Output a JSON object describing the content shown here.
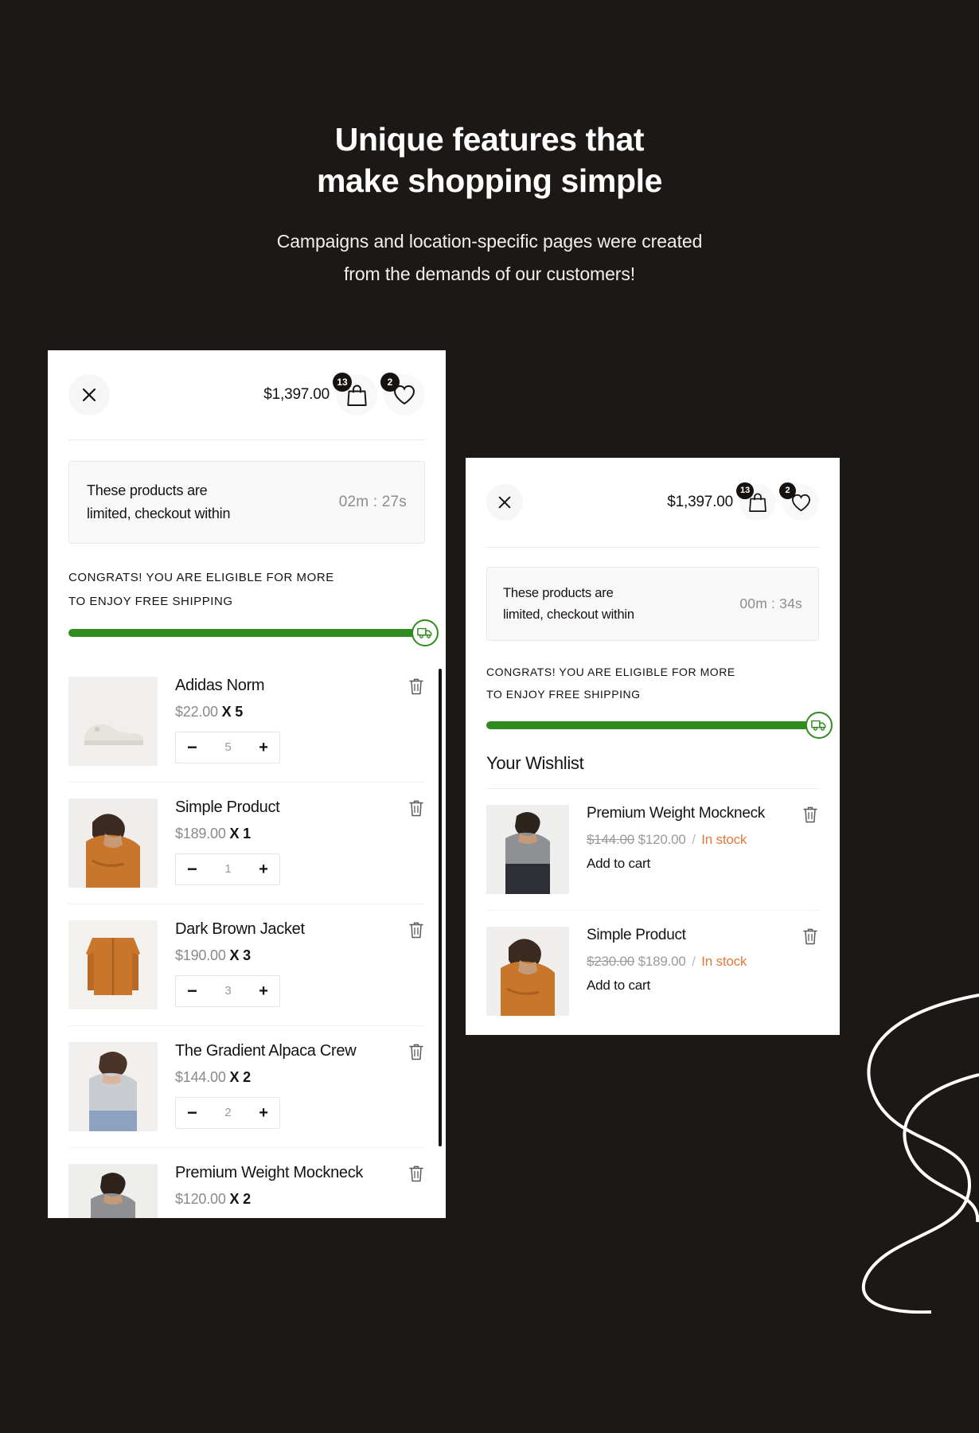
{
  "hero": {
    "title_line1": "Unique features that",
    "title_line2": "make shopping simple",
    "sub_line1": "Campaigns and location-specific pages were created",
    "sub_line2": "from the demands of our customers!"
  },
  "colors": {
    "background": "#1c1815",
    "panel": "#ffffff",
    "progress_green": "#2f8c1e",
    "stock_orange": "#e07b39",
    "badge_dark": "#16120f"
  },
  "cart_panel": {
    "close_icon": "close-icon",
    "cart_total": "$1,397.00",
    "cart_icon": "shopping-bag-icon",
    "cart_badge": "13",
    "wishlist_icon": "heart-icon",
    "wishlist_badge": "2",
    "timer_text_line1": "These products are",
    "timer_text_line2": "limited, checkout within",
    "timer_value": "02m : 27s",
    "shipping_line1": "CONGRATS! YOU ARE ELIGIBLE FOR MORE",
    "shipping_line2": "TO ENJOY FREE SHIPPING",
    "progress_percent": 100,
    "truck_icon": "delivery-truck-icon",
    "items": [
      {
        "name": "Adidas Norm",
        "price": "$22.00",
        "x": "X 5",
        "qty": "5",
        "thumb": "sneaker",
        "delete_icon": "trash-icon"
      },
      {
        "name": "Simple Product",
        "price": "$189.00",
        "x": "X 1",
        "qty": "1",
        "thumb": "woman-orange-sweater",
        "delete_icon": "trash-icon"
      },
      {
        "name": "Dark Brown Jacket",
        "price": "$190.00",
        "x": "X 3",
        "qty": "3",
        "thumb": "brown-jacket",
        "delete_icon": "trash-icon"
      },
      {
        "name": "The Gradient Alpaca Crew",
        "price": "$144.00",
        "x": "X 2",
        "qty": "2",
        "thumb": "grey-crew",
        "delete_icon": "trash-icon"
      },
      {
        "name": "Premium Weight Mockneck",
        "price": "$120.00",
        "x": "X 2",
        "qty": "2",
        "thumb": "man-grey-tee",
        "delete_icon": "trash-icon"
      }
    ]
  },
  "wishlist_panel": {
    "close_icon": "close-icon",
    "cart_total": "$1,397.00",
    "cart_icon": "shopping-bag-icon",
    "cart_badge": "13",
    "wishlist_icon": "heart-icon",
    "wishlist_badge": "2",
    "timer_text_line1": "These products are",
    "timer_text_line2": "limited, checkout within",
    "timer_value": "00m : 34s",
    "shipping_line1": "CONGRATS! YOU ARE ELIGIBLE FOR MORE",
    "shipping_line2": "TO ENJOY FREE SHIPPING",
    "progress_percent": 100,
    "truck_icon": "delivery-truck-icon",
    "heading": "Your Wishlist",
    "items": [
      {
        "name": "Premium Weight Mockneck",
        "old_price": "$144.00",
        "new_price": "$120.00",
        "separator": "/",
        "stock": "In stock",
        "add_to_cart": "Add to cart",
        "thumb": "man-grey-tee",
        "delete_icon": "trash-icon"
      },
      {
        "name": "Simple Product",
        "old_price": "$230.00",
        "new_price": "$189.00",
        "separator": "/",
        "stock": "In stock",
        "add_to_cart": "Add to cart",
        "thumb": "woman-orange-sweater",
        "delete_icon": "trash-icon"
      }
    ]
  }
}
